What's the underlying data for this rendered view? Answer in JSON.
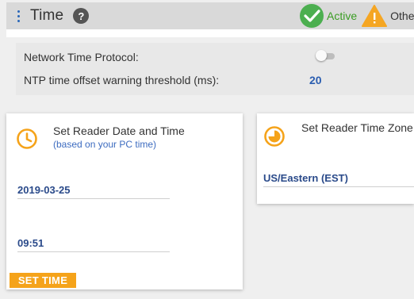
{
  "header": {
    "title": "Time",
    "help_icon": "question-icon",
    "help_symbol": "?",
    "status_active_label": "Active",
    "status_other_label": "Other",
    "active_color": "#4caf50",
    "warning_color": "#f5a623"
  },
  "ntp": {
    "protocol_label": "Network Time Protocol:",
    "protocol_enabled": false,
    "threshold_label": "NTP time offset warning threshold (ms):",
    "threshold_value": "20"
  },
  "date_card": {
    "title": "Set Reader Date and Time",
    "subtitle": "(based on your PC time)",
    "icon": "clock-icon",
    "date_value": "2019-03-25",
    "time_value": "09:51",
    "button_label": "SET TIME",
    "accent_color": "#f5a31a"
  },
  "tz_card": {
    "title": "Set Reader Time Zone",
    "icon": "timezone-icon",
    "timezone_value": "US/Eastern (EST)"
  }
}
